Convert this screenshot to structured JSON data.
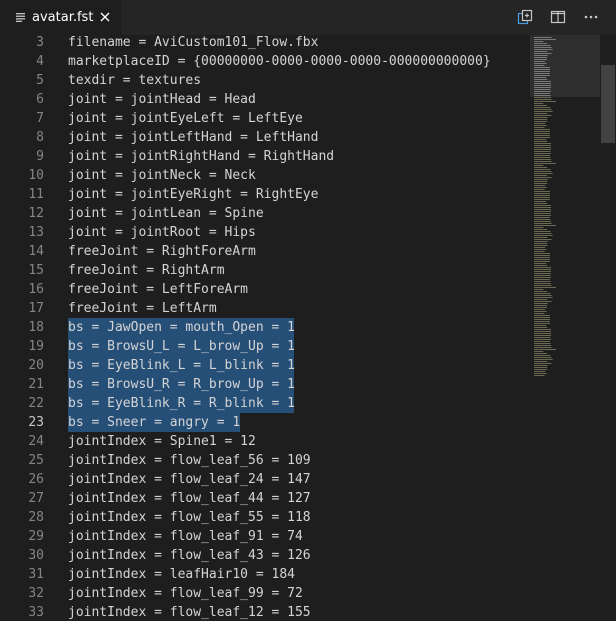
{
  "tab": {
    "filename": "avatar.fst",
    "file_icon": "lines-file-icon",
    "close_icon": "close-icon"
  },
  "toolbar": {
    "open_changes_icon": "open-changes-icon",
    "split_editor_icon": "split-editor-icon",
    "more_actions_icon": "more-actions-icon"
  },
  "colors": {
    "editor_bg": "#1e1e1e",
    "tabbar_bg": "#252526",
    "selection": "#264f78",
    "text": "#d4d4d4",
    "line_number": "#858585"
  },
  "editor": {
    "lines": [
      {
        "n": "3",
        "text": "filename = AviCustom101_Flow.fbx"
      },
      {
        "n": "4",
        "text": "marketplaceID = {00000000-0000-0000-0000-000000000000}"
      },
      {
        "n": "5",
        "text": "texdir = textures"
      },
      {
        "n": "6",
        "text": "joint = jointHead = Head"
      },
      {
        "n": "7",
        "text": "joint = jointEyeLeft = LeftEye"
      },
      {
        "n": "8",
        "text": "joint = jointLeftHand = LeftHand"
      },
      {
        "n": "9",
        "text": "joint = jointRightHand = RightHand"
      },
      {
        "n": "10",
        "text": "joint = jointNeck = Neck"
      },
      {
        "n": "11",
        "text": "joint = jointEyeRight = RightEye"
      },
      {
        "n": "12",
        "text": "joint = jointLean = Spine"
      },
      {
        "n": "13",
        "text": "joint = jointRoot = Hips"
      },
      {
        "n": "14",
        "text": "freeJoint = RightForeArm"
      },
      {
        "n": "15",
        "text": "freeJoint = RightArm"
      },
      {
        "n": "16",
        "text": "freeJoint = LeftForeArm"
      },
      {
        "n": "17",
        "text": "freeJoint = LeftArm"
      },
      {
        "n": "18",
        "text": "bs = JawOpen = mouth_Open = 1"
      },
      {
        "n": "19",
        "text": "bs = BrowsU_L = L_brow_Up = 1"
      },
      {
        "n": "20",
        "text": "bs = EyeBlink_L = L_blink = 1"
      },
      {
        "n": "21",
        "text": "bs = BrowsU_R = R_brow_Up = 1"
      },
      {
        "n": "22",
        "text": "bs = EyeBlink_R = R_blink = 1"
      },
      {
        "n": "23",
        "text": "bs = Sneer = angry = 1"
      },
      {
        "n": "24",
        "text": "jointIndex = Spine1 = 12"
      },
      {
        "n": "25",
        "text": "jointIndex = flow_leaf_56 = 109"
      },
      {
        "n": "26",
        "text": "jointIndex = flow_leaf_24 = 147"
      },
      {
        "n": "27",
        "text": "jointIndex = flow_leaf_44 = 127"
      },
      {
        "n": "28",
        "text": "jointIndex = flow_leaf_55 = 118"
      },
      {
        "n": "29",
        "text": "jointIndex = flow_leaf_91 = 74"
      },
      {
        "n": "30",
        "text": "jointIndex = flow_leaf_43 = 126"
      },
      {
        "n": "31",
        "text": "jointIndex = leafHair10 = 184"
      },
      {
        "n": "32",
        "text": "jointIndex = flow_leaf_99 = 72"
      },
      {
        "n": "33",
        "text": "jointIndex = flow_leaf_12 = 155"
      }
    ],
    "selection": {
      "first_line": "18",
      "last_line": "23"
    }
  }
}
